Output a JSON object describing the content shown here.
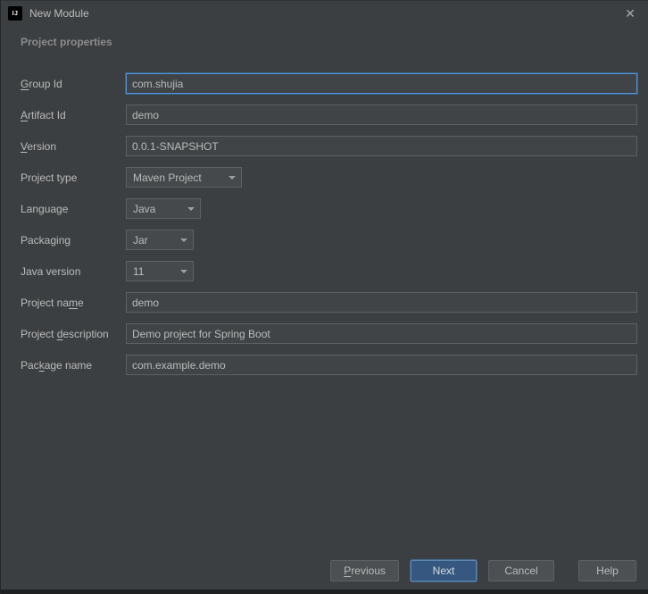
{
  "window": {
    "title": "New Module",
    "app_icon_text": "IJ",
    "close_glyph": "✕"
  },
  "section_title": "Project properties",
  "form": {
    "group_id": {
      "label_pre": "",
      "label_key": "G",
      "label_post": "roup Id",
      "value": "com.shujia"
    },
    "artifact_id": {
      "label_pre": "",
      "label_key": "A",
      "label_post": "rtifact Id",
      "value": "demo"
    },
    "version": {
      "label_pre": "",
      "label_key": "V",
      "label_post": "ersion",
      "value": "0.0.1-SNAPSHOT"
    },
    "project_type": {
      "label": "Project type",
      "value": "Maven Project"
    },
    "language": {
      "label": "Language",
      "value": "Java"
    },
    "packaging": {
      "label": "Packaging",
      "value": "Jar"
    },
    "java_version": {
      "label": "Java version",
      "value": "11"
    },
    "project_name": {
      "label_pre": "Project na",
      "label_key": "m",
      "label_post": "e",
      "value": "demo"
    },
    "project_description": {
      "label_pre": "Project ",
      "label_key": "d",
      "label_post": "escription",
      "value": "Demo project for Spring Boot"
    },
    "package_name": {
      "label_pre": "Pac",
      "label_key": "k",
      "label_post": "age name",
      "value": "com.example.demo"
    }
  },
  "buttons": {
    "previous": {
      "pre": "",
      "key": "P",
      "post": "revious"
    },
    "next": "Next",
    "cancel": "Cancel",
    "help": "Help"
  }
}
